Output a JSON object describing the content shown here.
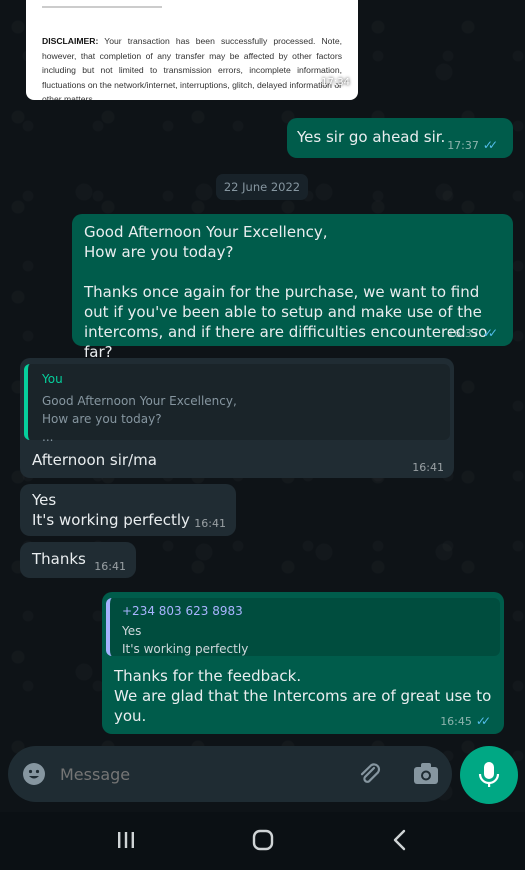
{
  "disclaimer": {
    "label": "DISCLAIMER:",
    "text": " Your transaction has been successfully processed. Note, however, that completion of any transfer may be affected by other factors including but not limited to transmission errors, incomplete information, fluctuations on the network/internet, interruptions, glitch, delayed information or other matters",
    "time": "17:34"
  },
  "messages": {
    "m1": {
      "text": "Yes sir go ahead sir.",
      "time": "17:37"
    },
    "date_chip": "22 June 2022",
    "m2": {
      "text": "Good Afternoon Your Excellency,\nHow are you today?\n\nThanks once again for the purchase, we want to find out if you've been able to setup and make use of the intercoms, and if there are difficulties encountered so far?",
      "time": "16:37"
    },
    "m3": {
      "quote_author": "You",
      "quote_text": "Good Afternoon Your Excellency,\nHow are you today?\n...",
      "text": "Afternoon sir/ma",
      "time": "16:41"
    },
    "m4": {
      "text": "Yes\nIt's working perfectly",
      "time": "16:41"
    },
    "m5": {
      "text": "Thanks",
      "time": "16:41"
    },
    "m6": {
      "quote_author": "+234 803 623 8983",
      "quote_text": "Yes\nIt's working perfectly",
      "text": "Thanks for the feedback.\nWe are glad that the Intercoms are of great use to you.",
      "time": "16:45"
    }
  },
  "input": {
    "placeholder": "Message"
  },
  "icons": {
    "emoji": "emoji-icon",
    "attach": "attach-icon",
    "camera": "camera-icon",
    "mic": "mic-icon",
    "nav_recent": "recent-apps-icon",
    "nav_home": "home-icon",
    "nav_back": "back-icon"
  },
  "colors": {
    "outgoing": "#005c4b",
    "incoming": "#202c33",
    "accent": "#00a884",
    "tick": "#53bdeb"
  }
}
